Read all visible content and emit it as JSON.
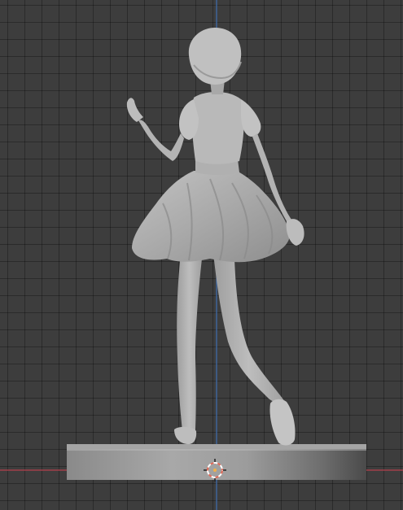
{
  "viewport": {
    "background_color": "#3d3d3d",
    "grid_color": "#2e2e2e",
    "axis_x_color": "#b6404c",
    "axis_z_color": "#3f6fb0"
  },
  "scene": {
    "model": "figurine-girl-in-skirt",
    "material_color": "#b4b4b4",
    "base_color": "#8c8c8c",
    "cursor_icon": "3d-cursor-icon"
  }
}
